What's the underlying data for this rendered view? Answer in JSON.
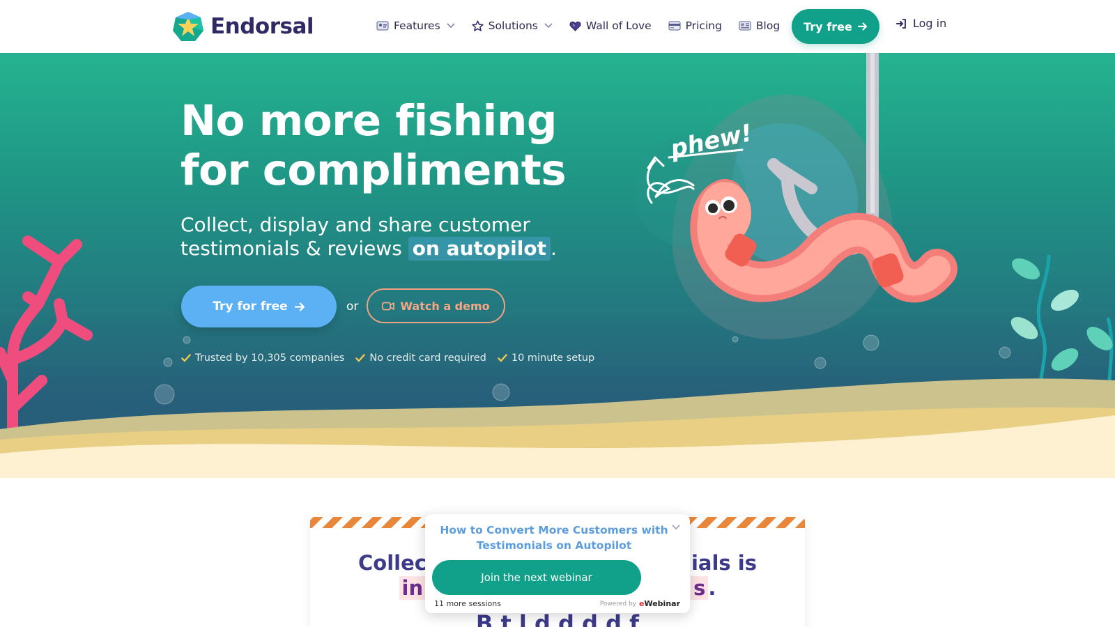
{
  "brand": {
    "name": "Endorsal"
  },
  "nav": {
    "items": [
      {
        "label": "Features",
        "icon": "id-card-icon",
        "has_dropdown": true
      },
      {
        "label": "Solutions",
        "icon": "star-icon",
        "has_dropdown": true
      },
      {
        "label": "Wall of Love",
        "icon": "heart-icon",
        "has_dropdown": false
      },
      {
        "label": "Pricing",
        "icon": "credit-card-icon",
        "has_dropdown": false
      },
      {
        "label": "Blog",
        "icon": "newspaper-icon",
        "has_dropdown": false
      }
    ],
    "cta": "Try free",
    "login": "Log in"
  },
  "hero": {
    "title": "No more fishing for compliments",
    "subtitle_line1": "Collect, display and share customer",
    "subtitle_line2": "testimonials & reviews",
    "subtitle_highlight": "on autopilot",
    "subtitle_end": ".",
    "primary_cta": "Try for free",
    "or": "or",
    "secondary_cta": "Watch a demo",
    "trust": [
      "Trusted by 10,305 companies",
      "No credit card required",
      "10 minute setup"
    ],
    "illustration_text": "phew!"
  },
  "card": {
    "heading_left": "Collec",
    "heading_right": "ials is",
    "heading_line2_left": "in",
    "heading_line2_right": "s",
    "heading_line2_end": ".",
    "sub_partial": "B  t  l  d       d       d         d       f"
  },
  "webinar": {
    "title": "How to Convert More Customers with Testimonials on Autopilot",
    "button": "Join the next webinar",
    "sessions": "11 more sessions",
    "powered_by": "Powered by",
    "provider_mark": "e",
    "provider": "Webinar"
  },
  "colors": {
    "brand_green": "#11a08a",
    "hero_top": "#25b390",
    "hero_bottom": "#285a78",
    "primary_button": "#5bb1f3",
    "demo_outline": "#f0a27e",
    "heading_navy": "#2f2a63"
  }
}
